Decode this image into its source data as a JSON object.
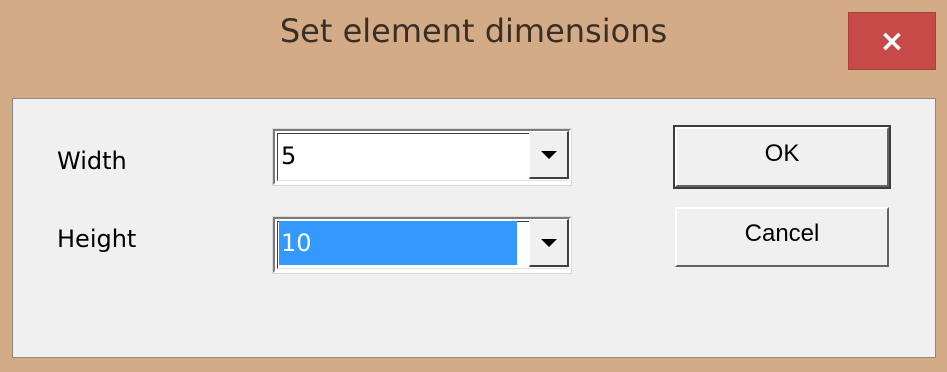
{
  "dialog": {
    "title": "Set element dimensions",
    "close_glyph": "×"
  },
  "fields": {
    "width": {
      "label": "Width",
      "value": "5"
    },
    "height": {
      "label": "Height",
      "value": "10"
    }
  },
  "buttons": {
    "ok_label": "OK",
    "cancel_label": "Cancel"
  },
  "colors": {
    "title_bar": "#d3ac87",
    "close_button": "#c74a48",
    "selection": "#3399ff",
    "client": "#f0f0f0"
  },
  "icons": {
    "close": "close-icon",
    "dropdown": "chevron-down-icon"
  }
}
